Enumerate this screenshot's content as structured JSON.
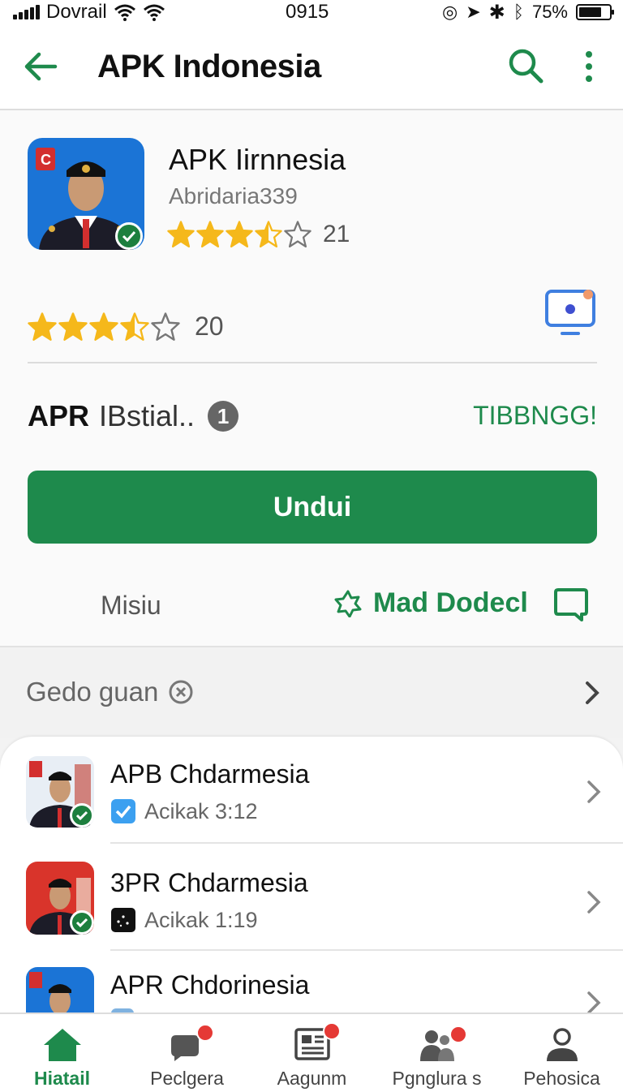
{
  "status_bar": {
    "carrier": "Dovrail",
    "time": "0915",
    "battery_percent": "75%",
    "battery_level": 0.75
  },
  "app_bar": {
    "title": "APK Indonesia",
    "back_icon": "arrow-left-icon",
    "search_icon": "search-icon",
    "more_icon": "more-vertical-icon"
  },
  "app_header": {
    "name": "APK Iirnnesia",
    "developer": "Abridaria339",
    "rating_stars": 3.5,
    "rating_count": "21"
  },
  "rating_row": {
    "stars": 3.5,
    "count": "20",
    "side_icon": "cast-screen-icon"
  },
  "install_row": {
    "title": "APR",
    "subtitle": "IBstial..",
    "badge": "1",
    "action": "TIBBNGG!"
  },
  "primary_button": "Undui",
  "secondary_row": {
    "left": "Misiu",
    "right": "Mad Dodecl",
    "right_icon": "badge-star-icon",
    "trailing_icon": "chat-bubble-icon"
  },
  "section": {
    "title": "Gedo guan",
    "title_icon": "circle-x-icon"
  },
  "list": [
    {
      "name": "APB Chdarmesia",
      "meta": "Acikak 3:12",
      "meta_icon": "blue-check-icon"
    },
    {
      "name": "3PR Chdarmesia",
      "meta": "Acikak 1:19",
      "meta_icon": "dark-square-icon"
    },
    {
      "name": "APR Chdorinesia",
      "meta": "",
      "meta_icon": "blue-check-icon"
    }
  ],
  "bottom_nav": [
    {
      "label": "Hiatail",
      "icon": "home-icon",
      "active": true
    },
    {
      "label": "Peclgera",
      "icon": "chat-icon",
      "active": false
    },
    {
      "label": "Aagunm",
      "icon": "newspaper-icon",
      "active": false
    },
    {
      "label": "Pgnglura s",
      "icon": "people-icon",
      "active": false
    },
    {
      "label": "Pehosica",
      "icon": "person-icon",
      "active": false
    }
  ],
  "colors": {
    "accent_green": "#1e8a4c",
    "star_yellow": "#f5b81b",
    "notification_red": "#e53935"
  }
}
